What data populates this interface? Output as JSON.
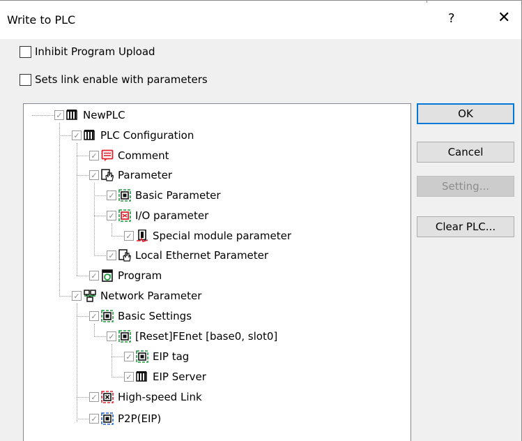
{
  "window": {
    "title": "Write to PLC",
    "help_glyph": "?",
    "close_glyph": "✕"
  },
  "options": {
    "inhibit_upload": {
      "label": "Inhibit Program Upload",
      "checked": false
    },
    "link_enable": {
      "label": "Sets link enable with parameters",
      "checked": false
    }
  },
  "tree": {
    "check_glyph": "✓",
    "nodes": [
      {
        "label": "NewPLC",
        "icon": "plc-icon",
        "checked": true
      },
      {
        "label": "PLC Configuration",
        "icon": "plc-icon",
        "checked": true
      },
      {
        "label": "Comment",
        "icon": "comment-icon",
        "checked": true
      },
      {
        "label": "Parameter",
        "icon": "parameter-hand-icon",
        "checked": true
      },
      {
        "label": "Basic Parameter",
        "icon": "basic-parameter-icon",
        "checked": true
      },
      {
        "label": "I/O parameter",
        "icon": "io-parameter-icon",
        "checked": true
      },
      {
        "label": "Special module parameter",
        "icon": "special-module-icon",
        "checked": true
      },
      {
        "label": "Local Ethernet Parameter",
        "icon": "parameter-hand-icon",
        "checked": true
      },
      {
        "label": "Program",
        "icon": "program-icon",
        "checked": true
      },
      {
        "label": "Network Parameter",
        "icon": "network-icon",
        "checked": true
      },
      {
        "label": "Basic Settings",
        "icon": "basic-settings-icon",
        "checked": true
      },
      {
        "label": "[Reset]FEnet [base0, slot0]",
        "icon": "fenet-icon",
        "checked": true
      },
      {
        "label": "EIP tag",
        "icon": "eip-tag-icon",
        "checked": true
      },
      {
        "label": "EIP Server",
        "icon": "plc-icon",
        "checked": true
      },
      {
        "label": "High-speed Link",
        "icon": "high-speed-link-icon",
        "checked": true
      },
      {
        "label": "P2P(EIP)",
        "icon": "p2p-icon",
        "checked": true
      }
    ]
  },
  "buttons": {
    "ok": "OK",
    "cancel": "Cancel",
    "setting": "Setting...",
    "clear": "Clear PLC..."
  },
  "colors": {
    "accent": "#0078d7",
    "red": "#e0202a",
    "green": "#1e9a3c",
    "blue": "#1f5fd6"
  }
}
